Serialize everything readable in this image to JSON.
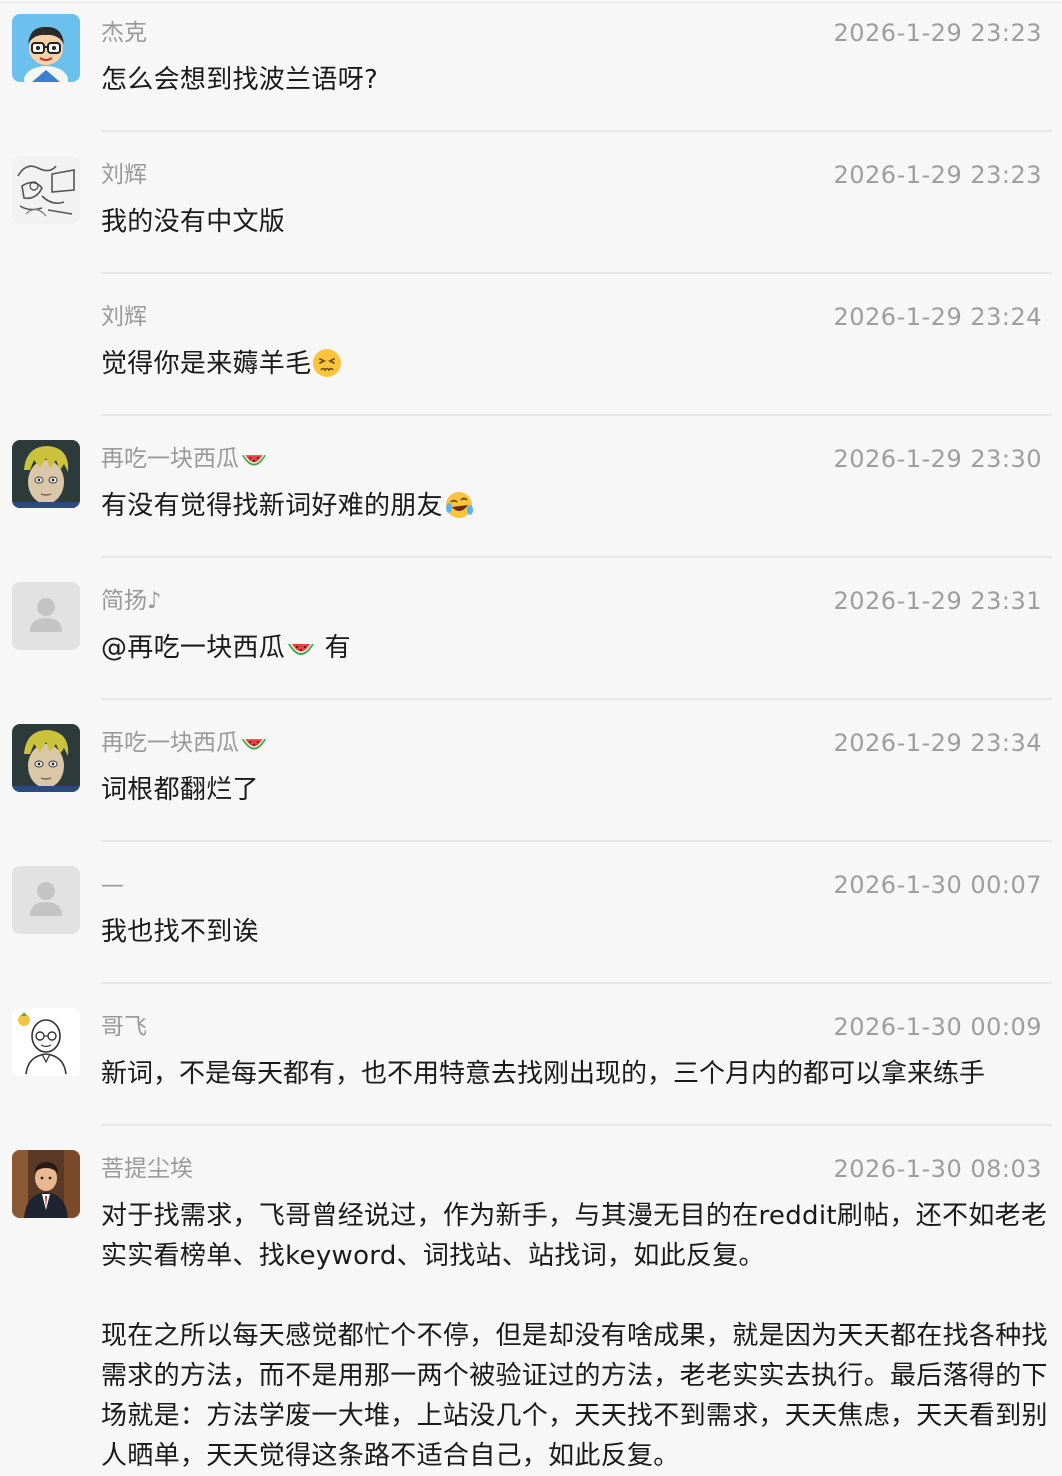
{
  "comments": [
    {
      "author": "杰克",
      "time": "2026-1-29 23:23",
      "text": "怎么会想到找波兰语呀?",
      "avatar": "cartoon-glasses-avatar"
    },
    {
      "author": "刘辉",
      "time": "2026-1-29 23:23",
      "text": "我的没有中文版",
      "avatar": "sketch-avatar"
    },
    {
      "author": "刘辉",
      "time": "2026-1-29 23:24",
      "text": "觉得你是来薅羊毛",
      "emoji": "persevering-face-emoji"
    },
    {
      "author": "再吃一块西瓜",
      "author_emoji": "watermelon-emoji",
      "time": "2026-1-29 23:30",
      "text": "有没有觉得找新词好难的朋友",
      "emoji": "crying-laughing-face-emoji",
      "avatar": "anime-blond-avatar"
    },
    {
      "author": "简扬♪",
      "time": "2026-1-29 23:31",
      "text_prefix": "@再吃一块西瓜",
      "text_suffix": " 有",
      "emoji": "watermelon-emoji",
      "avatar": "default-user-avatar"
    },
    {
      "author": "再吃一块西瓜",
      "author_emoji": "watermelon-emoji",
      "time": "2026-1-29 23:34",
      "text": "词根都翻烂了",
      "avatar": "anime-blond-avatar"
    },
    {
      "author": "—",
      "time": "2026-1-30 00:07",
      "text": "我也找不到诶",
      "avatar": "default-user-avatar"
    },
    {
      "author": "哥飞",
      "time": "2026-1-30 00:09",
      "text": "新词，不是每天都有，也不用特意去找刚出现的，三个月内的都可以拿来练手",
      "avatar": "bald-glasses-sketch-avatar"
    },
    {
      "author": "菩提尘埃",
      "time": "2026-1-30 08:03",
      "text": "对于找需求，飞哥曾经说过，作为新手，与其漫无目的在reddit刷帖，还不如老老实实看榜单、找keyword、词找站、站找词，如此反复。\n\n现在之所以每天感觉都忙个不停，但是却没有啥成果，就是因为天天都在找各种找需求的方法，而不是用那一两个被验证过的方法，老老实实去执行。最后落得的下场就是：方法学废一大堆，上站没几个，天天找不到需求，天天焦虑，天天看到别人晒单，天天觉得这条路不适合自己，如此反复。",
      "avatar": "man-in-suit-avatar"
    }
  ],
  "colors": {
    "background": "#f7f7f7",
    "name": "#9a9a9a",
    "time": "#9e9e9e",
    "text": "#1a1a1a",
    "divider": "#e8e8e8"
  }
}
